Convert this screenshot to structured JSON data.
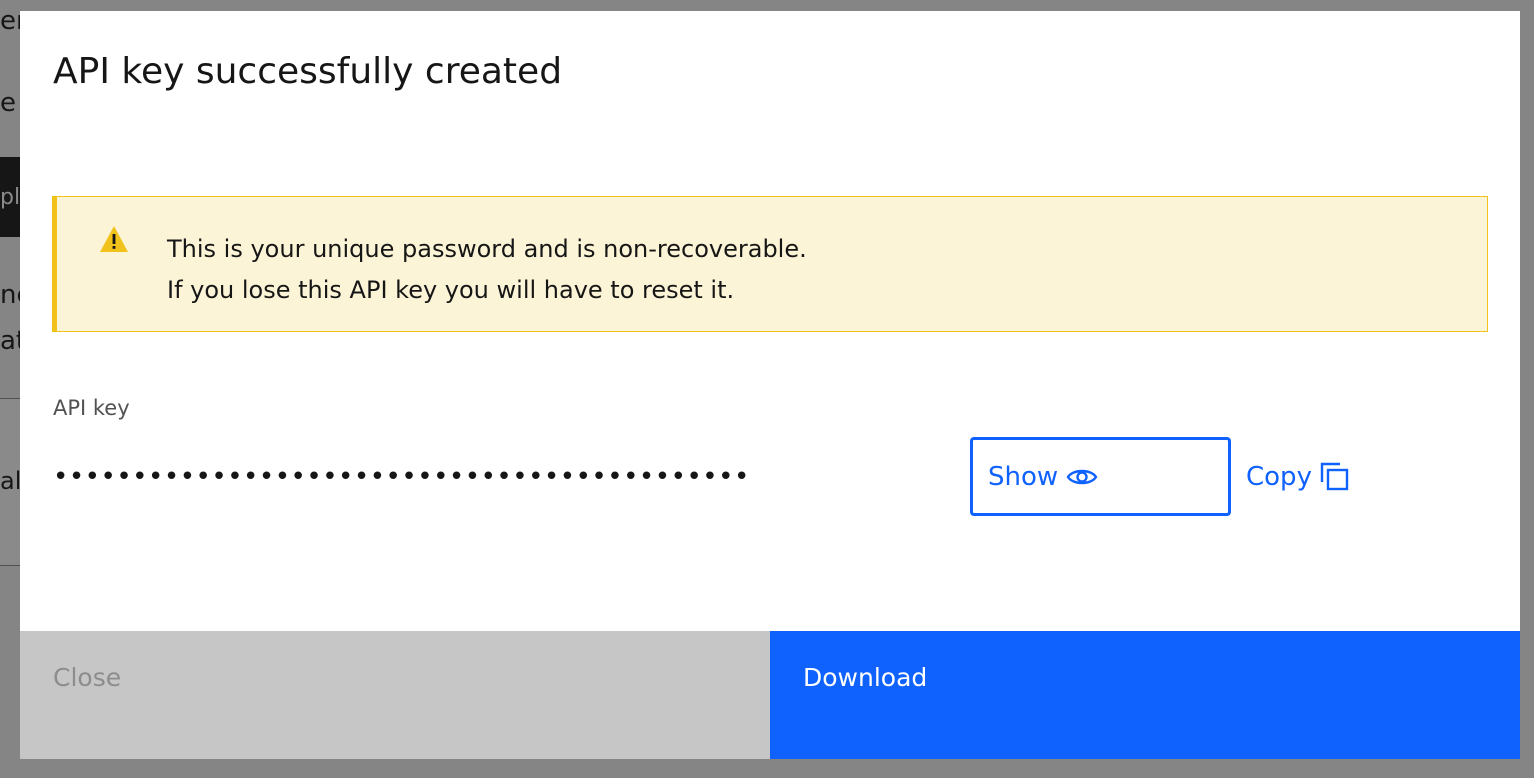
{
  "modal": {
    "title": "API key successfully created"
  },
  "notification": {
    "icon": "warning-icon",
    "line1": "This is your unique password and is non-recoverable.",
    "line2": "If you lose this API key you will have to reset it.",
    "colors": {
      "background": "#fcf4d6",
      "border": "#f1c21b"
    }
  },
  "api_key": {
    "label": "API key",
    "masked_value": "••••••••••••••••••••••••••••••••••••••••••••",
    "show_label": "Show",
    "show_icon": "eye-icon",
    "copy_label": "Copy",
    "copy_icon": "copy-icon"
  },
  "footer": {
    "close_label": "Close",
    "download_label": "Download"
  },
  "colors": {
    "primary": "#0f62fe",
    "disabled_bg": "#c6c6c6",
    "disabled_text": "#8d8d8d"
  }
}
